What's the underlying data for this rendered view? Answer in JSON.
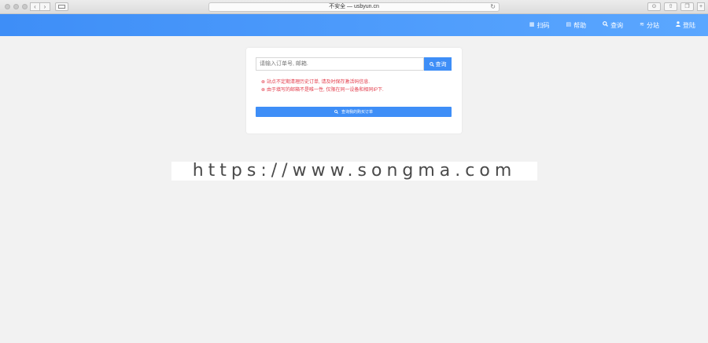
{
  "browser": {
    "url": "不安全 — usbyun.cn",
    "back_icon": "chevron-left-icon",
    "forward_icon": "chevron-right-icon"
  },
  "header": {
    "nav": [
      {
        "label": "扫码",
        "icon": "scan-icon"
      },
      {
        "label": "帮助",
        "icon": "help-icon"
      },
      {
        "label": "查询",
        "icon": "search-icon"
      },
      {
        "label": "分站",
        "icon": "database-icon"
      },
      {
        "label": "登陆",
        "icon": "user-icon"
      }
    ],
    "accent": "#3e8ef7"
  },
  "search": {
    "placeholder": "请输入订单号, 邮箱.",
    "value": "",
    "button_label": "查询"
  },
  "notices": [
    "站点不定期清理历史订单, 请及时保存激活码信息.",
    "由于填写的邮箱不是唯一性, 仅限在同一设备和相同IP下."
  ],
  "browse_button_label": "查询我的购买订单",
  "notice_color": "#e33c4b",
  "watermark": "https://www.songma.com"
}
